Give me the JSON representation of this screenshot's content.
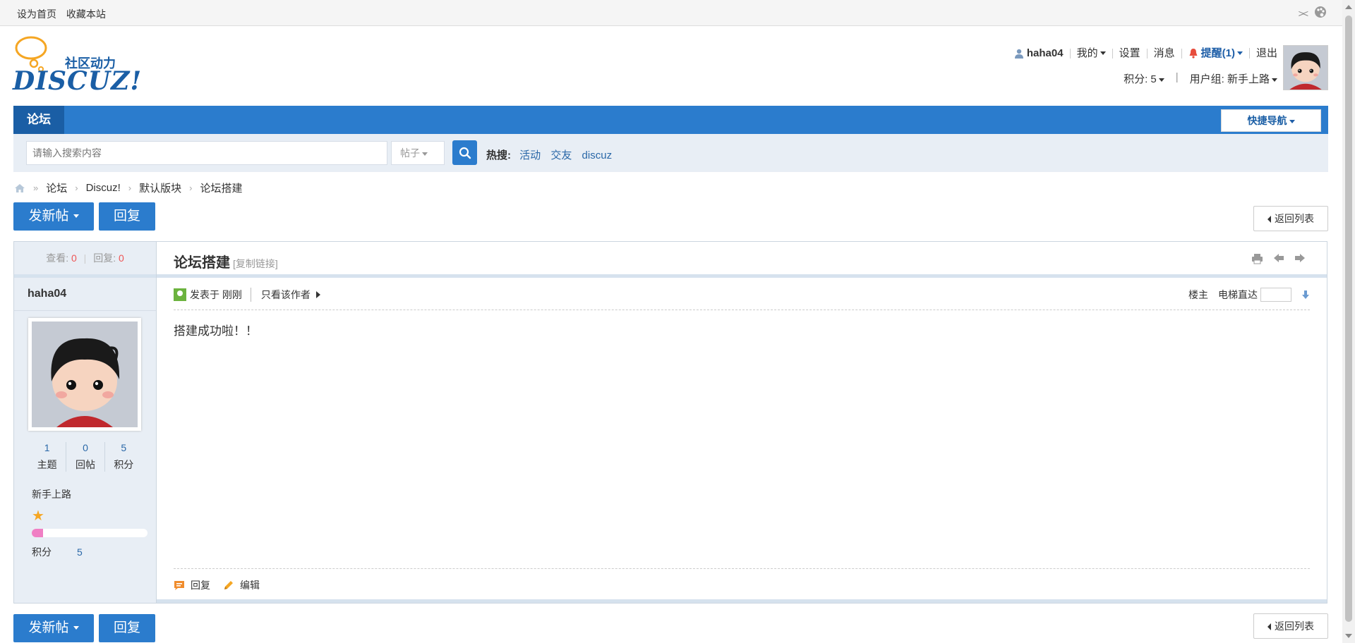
{
  "topbar": {
    "set_homepage": "设为首页",
    "bookmark": "收藏本站"
  },
  "logo": {
    "slogan": "社区动力",
    "brand": "DISCUZ!"
  },
  "user": {
    "name": "haha04",
    "mine": "我的",
    "settings": "设置",
    "messages": "消息",
    "reminders": "提醒(1)",
    "logout": "退出",
    "points": "积分: 5",
    "usergroup": "用户组: 新手上路"
  },
  "nav": {
    "forum": "论坛",
    "quicknav": "快捷导航"
  },
  "search": {
    "placeholder": "请输入搜索内容",
    "type": "帖子",
    "hot_label": "热搜:",
    "hot_items": [
      "活动",
      "交友",
      "discuz"
    ]
  },
  "breadcrumb": [
    "论坛",
    "Discuz!",
    "默认版块",
    "论坛搭建"
  ],
  "actions": {
    "new_post": "发新帖",
    "reply": "回复",
    "back_to_list": "返回列表"
  },
  "thread": {
    "views_label": "查看:",
    "views": "0",
    "replies_label": "回复:",
    "replies": "0",
    "title": "论坛搭建",
    "copy_link": "[复制链接]",
    "posted_at": "发表于 刚刚",
    "only_author": "只看该作者",
    "floor": "楼主",
    "elevator": "电梯直达",
    "body": "搭建成功啦！！",
    "reply": "回复",
    "edit": "编辑"
  },
  "author": {
    "name": "haha04",
    "topics": "1",
    "topics_label": "主题",
    "posts": "0",
    "posts_label": "回帖",
    "credits": "5",
    "credits_label": "积分",
    "group": "新手上路",
    "points_label": "积分",
    "points": "5",
    "progress": 0.1
  },
  "colors": {
    "accent": "#2b7ccd",
    "nav_active": "#1a5ea5",
    "link": "#2a68a8"
  }
}
